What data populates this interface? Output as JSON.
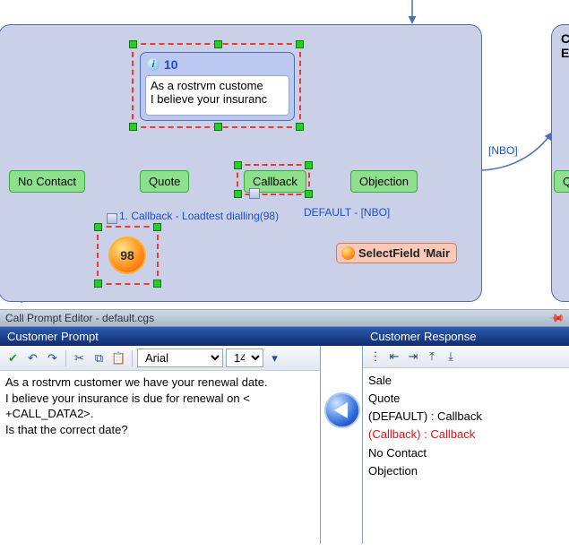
{
  "canvas": {
    "prompt": {
      "id": "10",
      "text1": "As a rostrvm custome",
      "text2": "I believe your insuranc"
    },
    "outcomes": {
      "noContact": "No Contact",
      "quote": "Quote",
      "callback": "Callback",
      "objection": "Objection",
      "quoteR": "Qu"
    },
    "edgeLabels": {
      "nbo": "[NBO]",
      "defaultNbo": "DEFAULT - [NBO]",
      "callbackLoad": "1. Callback - Loadtest dialling(98)"
    },
    "circle": "98",
    "action": "SelectField 'Mair",
    "rightTitle": "Call E"
  },
  "panel": {
    "title": "Call Prompt Editor - default.cgs",
    "colLeft": "Customer Prompt",
    "colRight": "Customer Response",
    "toolbar": {
      "font": "Arial",
      "size": "14"
    },
    "editorLines": [
      "As a rostrvm customer we have your renewal date.",
      "I believe your insurance is due for renewal on <",
      "+CALL_DATA2>.",
      "Is that the correct date?"
    ],
    "responses": {
      "sale": "Sale",
      "quote": "Quote",
      "def": "(DEFAULT) : Callback",
      "cb": "(Callback) : Callback",
      "nc": "No Contact",
      "obj": "Objection"
    }
  }
}
